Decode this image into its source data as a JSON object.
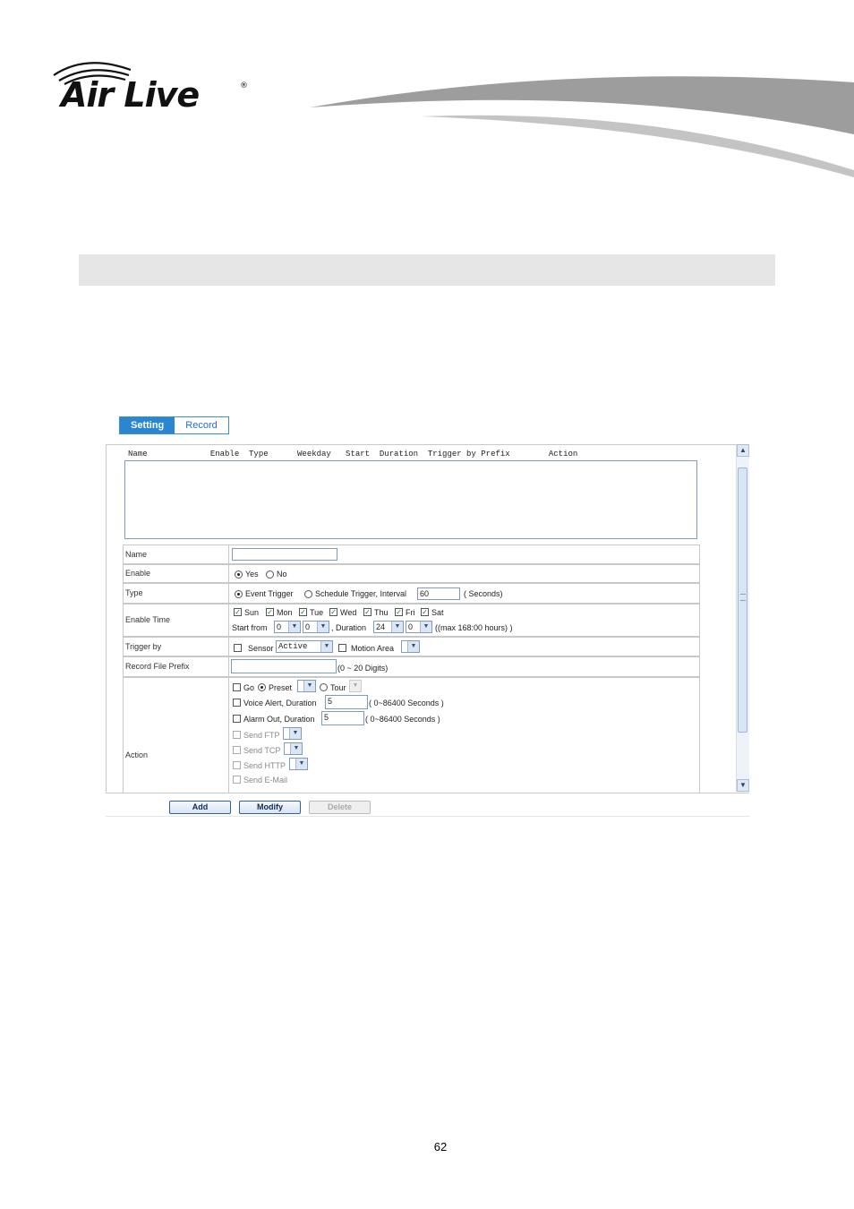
{
  "header": {
    "brand": "Air Live"
  },
  "tabs": [
    {
      "label": "Setting"
    },
    {
      "label": "Record"
    }
  ],
  "list": {
    "header": "Name             Enable  Type      Weekday   Start  Duration  Trigger by Prefix        Action"
  },
  "form": {
    "name": {
      "label": "Name",
      "value": ""
    },
    "enable": {
      "label": "Enable",
      "yes": "Yes",
      "no": "No"
    },
    "type": {
      "label": "Type",
      "event": "Event Trigger",
      "schedule": "Schedule Trigger, Interval",
      "interval": "60",
      "unit": "( Seconds)"
    },
    "enable_time": {
      "label": "Enable Time",
      "days": [
        "Sun",
        "Mon",
        "Tue",
        "Wed",
        "Thu",
        "Fri",
        "Sat"
      ],
      "start_from": "Start from",
      "hour": "0",
      "minute": "0",
      "duration_label": ", Duration",
      "dur_hour": "24",
      "dur_min": "0",
      "max_note": "((max 168:00 hours) )"
    },
    "trigger_by": {
      "label": "Trigger by",
      "sensor": "Sensor",
      "sensor_value": "Active",
      "motion": "Motion Area"
    },
    "prefix": {
      "label": "Record File Prefix",
      "note": "(0 ~ 20 Digits)"
    },
    "action": {
      "label": "Action",
      "go": "Go",
      "preset": "Preset",
      "tour": "Tour",
      "voice": "Voice Alert, Duration",
      "voice_value": "5",
      "voice_note": "( 0~86400 Seconds )",
      "alarm": "Alarm Out, Duration",
      "alarm_value": "5",
      "alarm_note": "( 0~86400 Seconds )",
      "ftp": "Send FTP",
      "tcp": "Send TCP",
      "http": "Send HTTP",
      "email": "Send E-Mail"
    }
  },
  "buttons": {
    "add": "Add",
    "modify": "Modify",
    "delete": "Delete"
  },
  "page_number": "62"
}
